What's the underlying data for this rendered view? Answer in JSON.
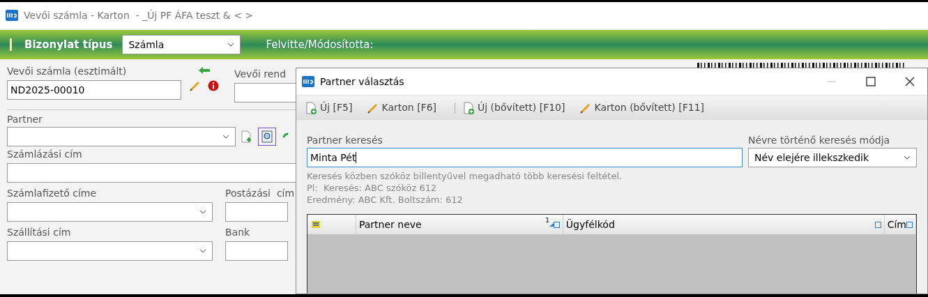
{
  "window": {
    "title": "Vevői számla - Karton  - _Új PF ÁFA teszt & < >"
  },
  "header_bar": {
    "label": "Bizonylat típus",
    "doc_type": "Számla",
    "modified_by_label": "Felvitte/Módosította:"
  },
  "form": {
    "invoice_label": "Vevői számla (esztimált)",
    "invoice_value": "ND2025-00010",
    "order_label": "Vevői rend",
    "partner_label": "Partner",
    "billing_label": "Számlázási cím",
    "payer_label": "Számlafizető címe",
    "postal_label": "Postázási  cím",
    "shipping_label": "Szállítási cím",
    "bank_label": "Bank"
  },
  "dialog": {
    "title": "Partner választás",
    "toolbar_groups": [
      [
        {
          "label": "Új [F5]",
          "kind": "new"
        },
        {
          "label": "Karton [F6]",
          "kind": "edit"
        }
      ],
      [
        {
          "label": "Új (bővített) [F10]",
          "kind": "new"
        },
        {
          "label": "Karton (bővített) [F11]",
          "kind": "edit"
        }
      ]
    ],
    "search_label": "Partner keresés",
    "search_value": "Minta Pét",
    "mode_label": "Névre történő keresés módja",
    "mode_value": "Név elejére illekszkedik",
    "hint": [
      "Keresés közben szóköz billentyűvel megadható több keresési feltétel.",
      "Pl:  Keresés: ABC szóköz 612",
      "Eredmény: ABC Kft. Boltszám: 612"
    ],
    "table": {
      "columns": [
        {
          "label": "Partner neve",
          "sort_index": "1"
        },
        {
          "label": "Ügyfélkód"
        },
        {
          "label": "Cím"
        }
      ]
    }
  }
}
